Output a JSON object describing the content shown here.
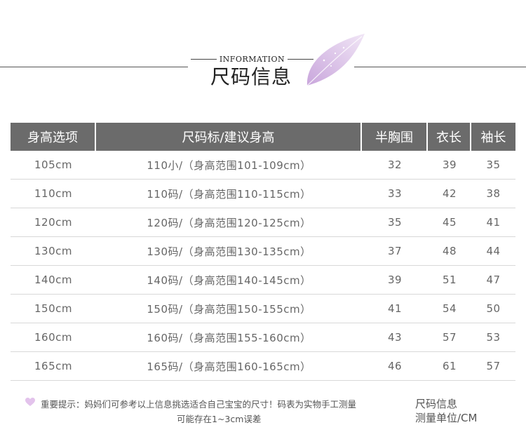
{
  "header": {
    "eyebrow": "INFORMATION",
    "title": "尺码信息"
  },
  "table": {
    "headers": [
      "身高选项",
      "尺码标/建议身高",
      "半胸围",
      "衣长",
      "袖长"
    ],
    "rows": [
      [
        "105cm",
        "110小/（身高范围101-109cm）",
        "32",
        "39",
        "35"
      ],
      [
        "110cm",
        "110码/（身高范围110-115cm）",
        "33",
        "42",
        "38"
      ],
      [
        "120cm",
        "120码/（身高范围120-125cm）",
        "35",
        "45",
        "41"
      ],
      [
        "130cm",
        "130码/（身高范围130-135cm）",
        "37",
        "48",
        "44"
      ],
      [
        "140cm",
        "140码/（身高范围140-145cm）",
        "39",
        "51",
        "47"
      ],
      [
        "150cm",
        "150码/（身高范围150-155cm）",
        "41",
        "54",
        "50"
      ],
      [
        "160cm",
        "160码/（身高范围155-160cm）",
        "43",
        "57",
        "53"
      ],
      [
        "165cm",
        "165码/（身高范围160-165cm）",
        "46",
        "61",
        "57"
      ]
    ]
  },
  "footer": {
    "tip_line1": "重要提示：妈妈们可参考以上信息挑选适合自己宝宝的尺寸！码表为实物手工测量",
    "tip_line2": "可能存在1~3cm误差",
    "side_line1": "尺码信息",
    "side_line2": "测量单位/CM"
  },
  "colors": {
    "header_bg": "#6b6b6b",
    "heart": "#e3c3ec",
    "leaf": "#d7b8e6"
  },
  "icons": {
    "leaf": "leaf-icon",
    "heart": "heart-icon"
  }
}
